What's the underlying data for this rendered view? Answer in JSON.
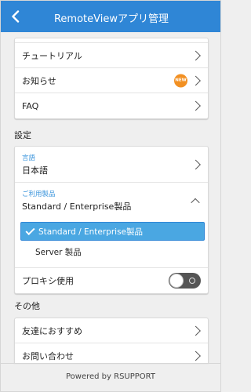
{
  "header": {
    "title": "RemoteViewアプリ管理"
  },
  "help_items": [
    {
      "label": "チュートリアル"
    },
    {
      "label": "お知らせ",
      "badge": "NEW"
    },
    {
      "label": "FAQ"
    }
  ],
  "settings": {
    "section_title": "設定",
    "language": {
      "label": "言語",
      "value": "日本語"
    },
    "product": {
      "label": "ご利用製品",
      "value": "Standard / Enterprise製品",
      "options": [
        {
          "label": "Standard / Enterprise製品",
          "selected": true
        },
        {
          "label": "Server 製品",
          "selected": false
        }
      ]
    },
    "proxy": {
      "label": "プロキシ使用",
      "enabled": false
    }
  },
  "other": {
    "section_title": "その他",
    "items": [
      {
        "label": "友達におすすめ"
      },
      {
        "label": "お問い合わせ"
      }
    ]
  },
  "footer": {
    "text": "Powered by RSUPPORT"
  },
  "colors": {
    "header": "#2f86d6",
    "accent_text": "#3b95dc",
    "selected_bg": "#4aa7e2",
    "badge": "#f29022"
  }
}
